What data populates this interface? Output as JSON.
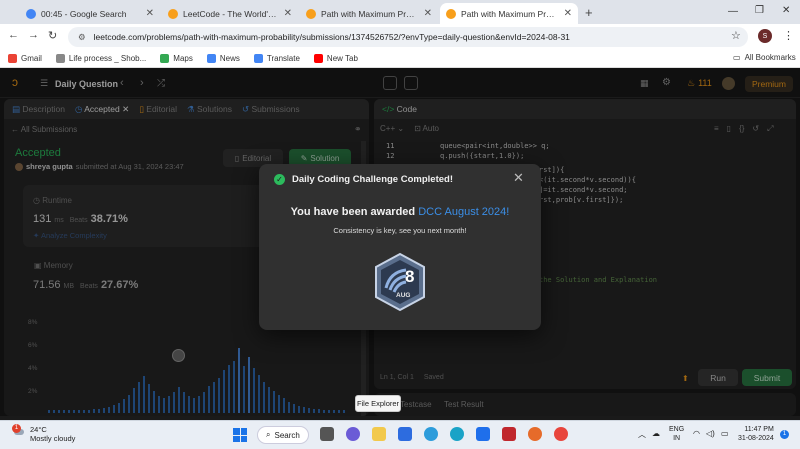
{
  "browser": {
    "tabs": [
      {
        "title": "00:45 - Google Search",
        "color": "#4285f4"
      },
      {
        "title": "LeetCode - The World's Leading",
        "color": "#f89f1b"
      },
      {
        "title": "Path with Maximum Probability",
        "color": "#f89f1b"
      },
      {
        "title": "Path with Maximum Probability",
        "color": "#f89f1b"
      }
    ],
    "url": "leetcode.com/problems/path-with-maximum-probability/submissions/1374526752/?envType=daily-question&envId=2024-08-31",
    "profile_initial": "S",
    "bookmarks": [
      {
        "label": "Gmail",
        "color": "#ea4335"
      },
      {
        "label": "Life process _ Shob...",
        "color": "#888"
      },
      {
        "label": "Maps",
        "color": "#34a853"
      },
      {
        "label": "News",
        "color": "#4285f4"
      },
      {
        "label": "Translate",
        "color": "#4285f4"
      },
      {
        "label": "New Tab",
        "color": "#ff0000"
      }
    ],
    "all_bookmarks": "All Bookmarks"
  },
  "lc": {
    "daily_question": "Daily Question",
    "streak": "111",
    "premium": "Premium",
    "left_tabs": [
      "Description",
      "Accepted",
      "Editorial",
      "Solutions",
      "Submissions"
    ],
    "all_submissions": "All Submissions",
    "status": "Accepted",
    "user": "shreya gupta",
    "submitted": "submitted at Aug 31, 2024 23:47",
    "editorial_btn": "Editorial",
    "solution_btn": "Solution",
    "runtime_label": "Runtime",
    "runtime_value": "131",
    "runtime_unit": "ms",
    "beats_label": "Beats",
    "runtime_beats": "38.71%",
    "analyze": "Analyze Complexity",
    "memory_label": "Memory",
    "memory_value": "71.56",
    "memory_unit": "MB",
    "memory_beats": "27.67%",
    "y_ticks": [
      "8%",
      "6%",
      "4%",
      "2%"
    ],
    "code_tab": "Code",
    "lang": "C++",
    "auto": "Auto",
    "line_numbers": [
      "11",
      "12"
    ],
    "code_lines": [
      "queue<pair<int,double>> q;",
      "q.push({start,1.0});"
    ],
    "code_partial": [
      "rst]){",
      "<(it.second*v.second)){",
      "]=it.second*v.second;",
      "rst,prob[v.first]});",
      "the Solution and Explanation"
    ],
    "cursor": "Ln 1, Col 1",
    "saved": "Saved",
    "run": "Run",
    "submit": "Submit",
    "bottom_tabs": [
      "Testcase",
      "Test Result"
    ],
    "tooltip": "File Explorer"
  },
  "modal": {
    "title": "Daily Coding Challenge Completed!",
    "awarded_prefix": "You have been awarded",
    "award": "DCC August 2024!",
    "subtitle": "Consistency is key, see you next month!",
    "badge_number": "8",
    "badge_month": "AUG"
  },
  "chart_data": {
    "type": "bar",
    "title": "",
    "ylabel": "",
    "yticks": [
      "8%",
      "6%",
      "4%",
      "2%"
    ],
    "ylim": [
      0,
      9
    ],
    "values": [
      0.3,
      0.3,
      0.3,
      0.3,
      0.3,
      0.3,
      0.3,
      0.3,
      0.3,
      0.4,
      0.4,
      0.5,
      0.6,
      0.8,
      1.0,
      1.3,
      1.7,
      2.4,
      3.0,
      3.5,
      2.8,
      2.1,
      1.6,
      1.4,
      1.6,
      2.0,
      2.5,
      2.0,
      1.6,
      1.4,
      1.6,
      2.0,
      2.6,
      3.0,
      3.4,
      4.1,
      4.6,
      5.0,
      6.2,
      4.5,
      5.4,
      4.3,
      3.6,
      3.0,
      2.5,
      2.1,
      1.7,
      1.4,
      1.1,
      0.9,
      0.7,
      0.6,
      0.5,
      0.4,
      0.4,
      0.3,
      0.3,
      0.3,
      0.3,
      0.3
    ]
  },
  "taskbar": {
    "temp": "24°C",
    "weather": "Mostly cloudy",
    "search": "Search",
    "lang1": "ENG",
    "lang2": "IN",
    "time": "11:47 PM",
    "date": "31-08-2024",
    "notif": "1"
  }
}
